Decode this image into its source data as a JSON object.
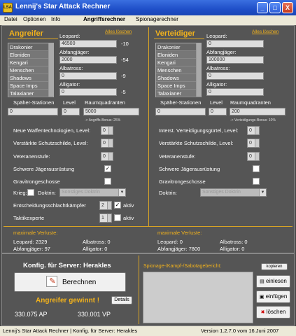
{
  "window": {
    "title": "Lennij's Star Attack Rechner",
    "icon": "app-icon",
    "minimize": "_",
    "maximize": "□",
    "close": "X"
  },
  "menu": {
    "items": [
      "Datei",
      "Optionen",
      "Info"
    ],
    "tab_active": "Angriffsrechner",
    "tab_other": "Spionagerechner"
  },
  "attacker": {
    "title": "Angreifer",
    "clear_link": "Alles löschen",
    "leopard_label": "Leopard:",
    "races": [
      "Drakonier",
      "Eloniden",
      "Kengari",
      "Menschen",
      "Shadows",
      "Space Imps",
      "Talaxianer"
    ],
    "fields": [
      {
        "label": "",
        "value": "46500",
        "loss": "-10"
      },
      {
        "label": "Abfangjäger:",
        "value": "2000",
        "loss": "-54"
      },
      {
        "label": "Albatross:",
        "value": "0",
        "loss": "-9"
      },
      {
        "label": "Alligator:",
        "value": "0",
        "loss": "-5"
      }
    ],
    "spy_label": "Späher-Stationen",
    "level_label": "Level",
    "quadrant_label": "Raumquadranten",
    "spy_value": "0",
    "level_value": "0",
    "quadrant_value": "5000",
    "bonus_note": "-> Angriffs-Bonus: 25%",
    "opt1_label": "Neue Waffentechnologien, Level:",
    "opt1_value": "0",
    "opt2_label": "Verstärkte Schutzschilde, Level:",
    "opt2_value": "0",
    "opt3_label": "Veteranenstufe:",
    "opt3_value": "0",
    "opt4_label": "Schwere Jägerausrüstung",
    "opt4_check": "✓",
    "opt5_label": "Gravitrongeschosse",
    "war_label": "Krieg:",
    "doctrine_label": "Doktrin:",
    "doctrine_value": "Sonstiges Doktrin",
    "decisive_label": "Entscheidungsschlachtkämpfer",
    "decisive_value": "2",
    "aktiv": "aktiv",
    "tactic_label": "Taktikexperte",
    "tactic_value": "1",
    "tactic_aktiv": "aktiv"
  },
  "defender": {
    "title": "Verteidiger",
    "clear_link": "Alles löschen",
    "leopard_label": "Leopard:",
    "races": [
      "Drakonier",
      "Eloniden",
      "Kengari",
      "Menschen",
      "Shadows",
      "Space Imps",
      "Talaxianer"
    ],
    "fields": [
      {
        "label": "",
        "value": "0"
      },
      {
        "label": "Abfangjäger:",
        "value": "100000"
      },
      {
        "label": "Albatross:",
        "value": "0"
      },
      {
        "label": "Alligator:",
        "value": "0"
      }
    ],
    "spy_label": "Späher-Stationen",
    "level_label": "Level",
    "quadrant_label": "Raumquadranten",
    "spy_value": "0",
    "level_value": "0",
    "quadrant_value": "200",
    "bonus_note": "-> Verteidigungs-Bonus: 10%",
    "opt1_label": "Interst. Verteidigungsgürtel, Level:",
    "opt1_value": "0",
    "opt2_label": "Verstärkte Schutzschilde, Level:",
    "opt2_value": "0",
    "opt3_label": "Veteranenstufe:",
    "opt3_value": "0",
    "opt4_label": "Schwere Jägerausrüstung",
    "opt5_label": "Gravitrongeschosse",
    "doctrine_label": "Doktrin:",
    "doctrine_value": "Sonstiges Doktrin"
  },
  "losses": {
    "att_title": "maximale Verluste:",
    "att_leopard": "Leopard: 2329",
    "att_abf": "Abfangjäger: 97",
    "att_alb": "Albatross: 0",
    "att_all": "Alligator: 0",
    "def_title": "maximale Verluste:",
    "def_leopard": "Leopard: 0",
    "def_abf": "Abfangjäger: 7800",
    "def_alb": "Albatross: 0",
    "def_all": "Alligator: 0"
  },
  "bottom": {
    "config": "Konfig. für Server: Herakles",
    "calc_button": "Berechnen",
    "result": "Angreifer gewinnt !",
    "details": "Details",
    "ap": "330.075 AP",
    "vp": "330.001 VP",
    "report_label": "Spionage-/Kampf-/Sabotagebericht:",
    "copy": "kopieren",
    "load": "einlesen",
    "paste": "einfügen",
    "delete": "löschen"
  },
  "status": {
    "left": "Lennij's Star Attack Rechner | Konfig. für Server: Herakles",
    "right": "Version 1.2.7.0 vom 16.Juni 2007"
  }
}
